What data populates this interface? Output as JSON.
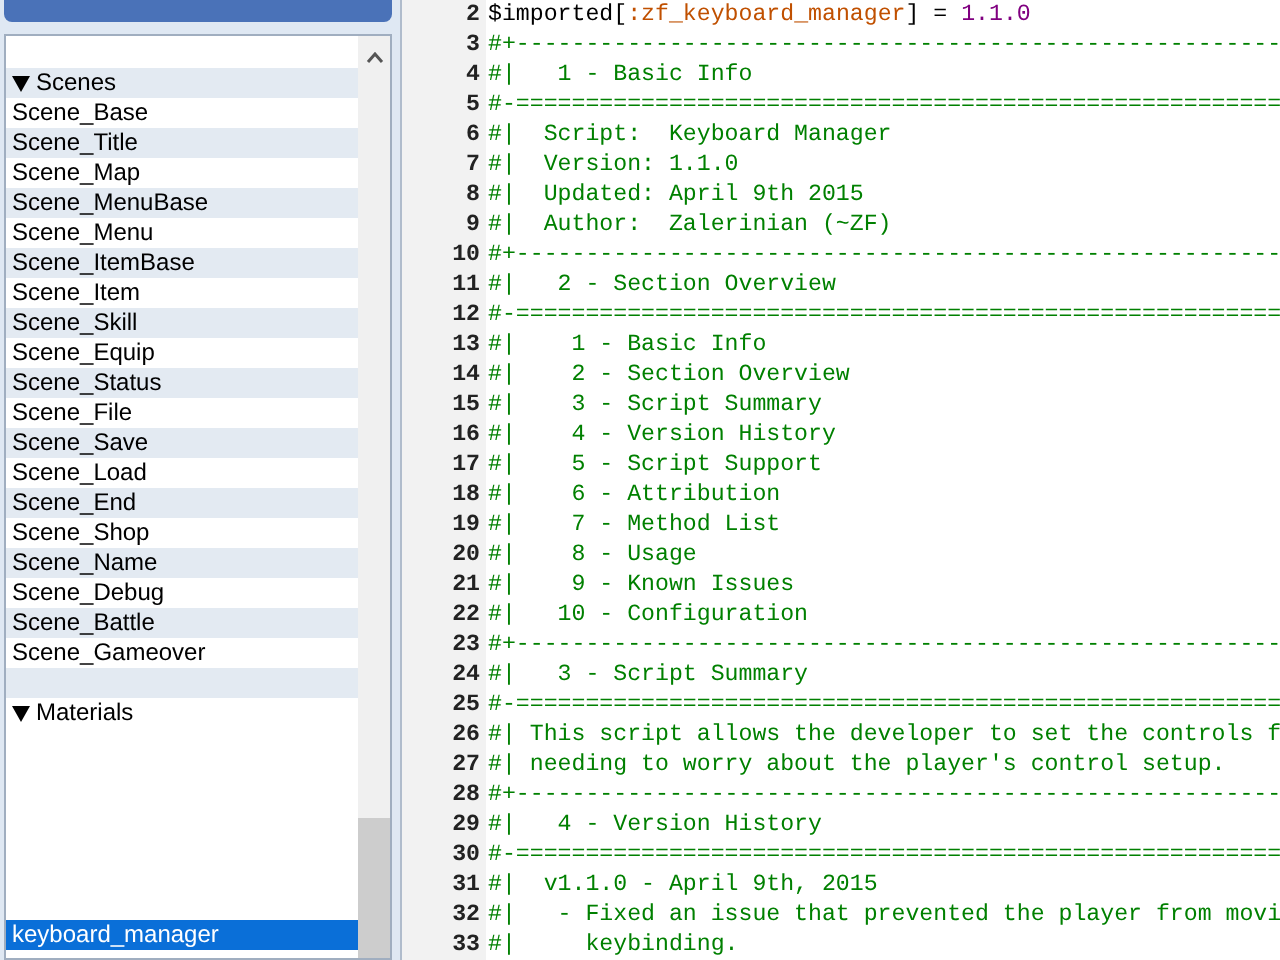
{
  "sidebar": {
    "groups": [
      {
        "label": "Scenes",
        "expanded": true,
        "items": [
          {
            "label": "Scene_Base",
            "selected": false
          },
          {
            "label": "Scene_Title",
            "selected": false
          },
          {
            "label": "Scene_Map",
            "selected": false
          },
          {
            "label": "Scene_MenuBase",
            "selected": false
          },
          {
            "label": "Scene_Menu",
            "selected": false
          },
          {
            "label": "Scene_ItemBase",
            "selected": false
          },
          {
            "label": "Scene_Item",
            "selected": false
          },
          {
            "label": "Scene_Skill",
            "selected": false
          },
          {
            "label": "Scene_Equip",
            "selected": false
          },
          {
            "label": "Scene_Status",
            "selected": false
          },
          {
            "label": "Scene_File",
            "selected": false
          },
          {
            "label": "Scene_Save",
            "selected": false
          },
          {
            "label": "Scene_Load",
            "selected": false
          },
          {
            "label": "Scene_End",
            "selected": false
          },
          {
            "label": "Scene_Shop",
            "selected": false
          },
          {
            "label": "Scene_Name",
            "selected": false
          },
          {
            "label": "Scene_Debug",
            "selected": false
          },
          {
            "label": "Scene_Battle",
            "selected": false
          },
          {
            "label": "Scene_Gameover",
            "selected": false
          }
        ]
      },
      {
        "label": "Materials",
        "expanded": true,
        "items": [
          {
            "label": "keyboard_manager",
            "selected": true
          }
        ]
      }
    ]
  },
  "editor": {
    "lines": [
      {
        "number": "2",
        "kind": "code",
        "tokens": [
          {
            "text": "$imported",
            "kind": "plain"
          },
          {
            "text": "[",
            "kind": "plain"
          },
          {
            "text": ":zf_keyboard_manager",
            "kind": "symbol"
          },
          {
            "text": "] = ",
            "kind": "plain"
          },
          {
            "text": "1.1.0",
            "kind": "number"
          }
        ]
      },
      {
        "number": "3",
        "kind": "comment",
        "text": "#+-------------------------------------------------------"
      },
      {
        "number": "4",
        "kind": "comment",
        "text": "#|   1 - Basic Info"
      },
      {
        "number": "5",
        "kind": "comment",
        "text": "#-======================================================="
      },
      {
        "number": "6",
        "kind": "comment",
        "text": "#|  Script:  Keyboard Manager"
      },
      {
        "number": "7",
        "kind": "comment",
        "text": "#|  Version: 1.1.0"
      },
      {
        "number": "8",
        "kind": "comment",
        "text": "#|  Updated: April 9th 2015"
      },
      {
        "number": "9",
        "kind": "comment",
        "text": "#|  Author:  Zalerinian (~ZF)"
      },
      {
        "number": "10",
        "kind": "comment",
        "text": "#+-------------------------------------------------------"
      },
      {
        "number": "11",
        "kind": "comment",
        "text": "#|   2 - Section Overview"
      },
      {
        "number": "12",
        "kind": "comment",
        "text": "#-======================================================="
      },
      {
        "number": "13",
        "kind": "comment",
        "text": "#|    1 - Basic Info"
      },
      {
        "number": "14",
        "kind": "comment",
        "text": "#|    2 - Section Overview"
      },
      {
        "number": "15",
        "kind": "comment",
        "text": "#|    3 - Script Summary"
      },
      {
        "number": "16",
        "kind": "comment",
        "text": "#|    4 - Version History"
      },
      {
        "number": "17",
        "kind": "comment",
        "text": "#|    5 - Script Support"
      },
      {
        "number": "18",
        "kind": "comment",
        "text": "#|    6 - Attribution"
      },
      {
        "number": "19",
        "kind": "comment",
        "text": "#|    7 - Method List"
      },
      {
        "number": "20",
        "kind": "comment",
        "text": "#|    8 - Usage"
      },
      {
        "number": "21",
        "kind": "comment",
        "text": "#|    9 - Known Issues"
      },
      {
        "number": "22",
        "kind": "comment",
        "text": "#|   10 - Configuration"
      },
      {
        "number": "23",
        "kind": "comment",
        "text": "#+-------------------------------------------------------"
      },
      {
        "number": "24",
        "kind": "comment",
        "text": "#|   3 - Script Summary"
      },
      {
        "number": "25",
        "kind": "comment",
        "text": "#-======================================================="
      },
      {
        "number": "26",
        "kind": "comment",
        "text": "#| This script allows the developer to set the controls f"
      },
      {
        "number": "27",
        "kind": "comment",
        "text": "#| needing to worry about the player's control setup."
      },
      {
        "number": "28",
        "kind": "comment",
        "text": "#+-------------------------------------------------------"
      },
      {
        "number": "29",
        "kind": "comment",
        "text": "#|   4 - Version History"
      },
      {
        "number": "30",
        "kind": "comment",
        "text": "#-======================================================="
      },
      {
        "number": "31",
        "kind": "comment",
        "text": "#|  v1.1.0 - April 9th, 2015"
      },
      {
        "number": "32",
        "kind": "comment",
        "text": "#|   - Fixed an issue that prevented the player from movi"
      },
      {
        "number": "33",
        "kind": "comment",
        "text": "#|     keybinding."
      }
    ]
  }
}
